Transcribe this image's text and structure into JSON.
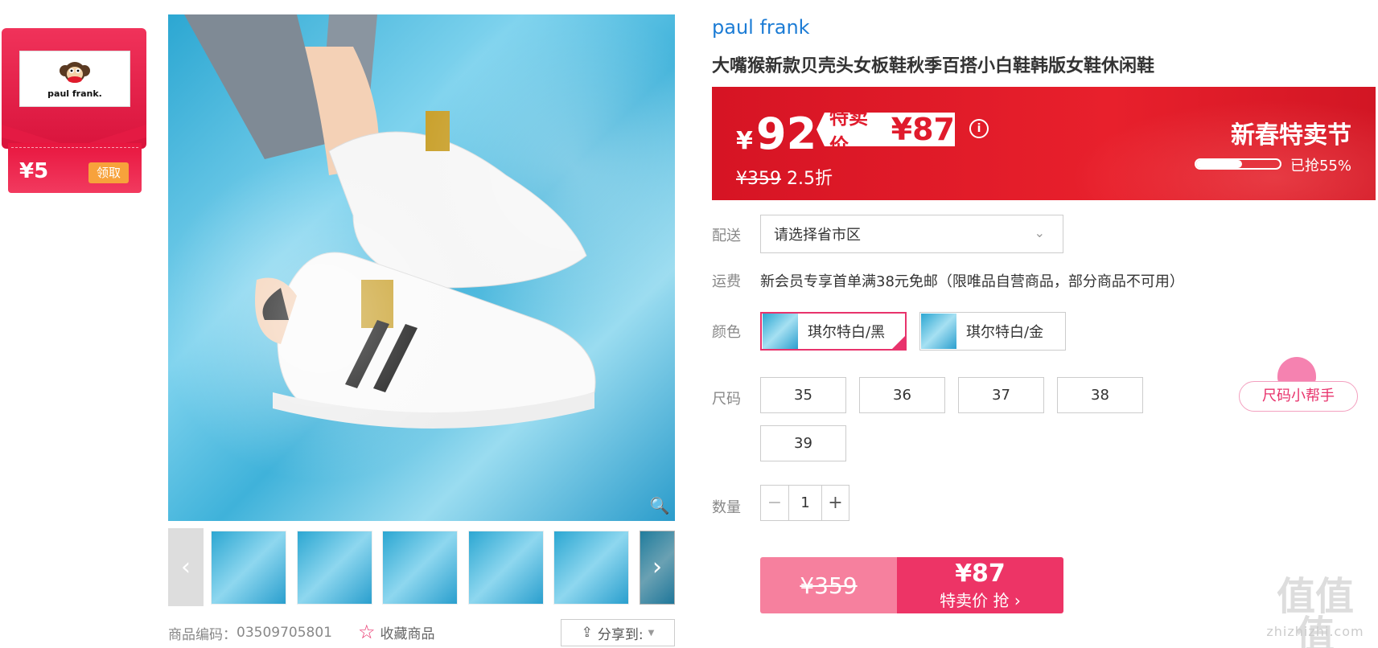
{
  "coupon": {
    "brand_logo_text": "paul frank.",
    "amount": "¥5",
    "get_label": "领取"
  },
  "gallery": {
    "thumbnails": [
      "thumb-1",
      "thumb-2",
      "thumb-3",
      "thumb-4",
      "thumb-5",
      "thumb-6"
    ],
    "product_code_label": "商品编码：",
    "product_code": "03509705801",
    "favorite_label": "收藏商品",
    "share_label": "分享到:"
  },
  "product": {
    "brand": "paul frank",
    "title": "大嘴猴新款贝壳头女板鞋秋季百搭小白鞋韩版女鞋休闲鞋"
  },
  "price": {
    "yen": "¥",
    "current": "92",
    "tag_label": "特卖价",
    "tag_price": "¥87",
    "original": "¥359",
    "discount": "2.5折",
    "festival": "新春特卖节",
    "grabbed_label": "已抢55%",
    "grabbed_fraction": 0.55,
    "info_icon": "info-icon"
  },
  "delivery": {
    "label": "配送",
    "placeholder": "请选择省市区"
  },
  "shipping": {
    "label": "运费",
    "text": "新会员专享首单满38元免邮（限唯品自营商品，部分商品不可用）"
  },
  "color": {
    "label": "颜色",
    "options": [
      "琪尔特白/黑",
      "琪尔特白/金"
    ],
    "selected_index": 0
  },
  "size": {
    "label": "尺码",
    "options": [
      "35",
      "36",
      "37",
      "38",
      "39"
    ],
    "helper": "尺码小帮手"
  },
  "quantity": {
    "label": "数量",
    "value": "1",
    "minus": "−",
    "plus": "+"
  },
  "buy": {
    "original": "¥359",
    "price": "¥87",
    "action": "特卖价 抢 ›"
  },
  "watermark": {
    "main": "值值值",
    "sub": "zhizhizhi.com"
  },
  "colors": {
    "accent": "#e8336c",
    "banner_red": "#e01b2c",
    "brand_blue": "#1c7cd5"
  }
}
